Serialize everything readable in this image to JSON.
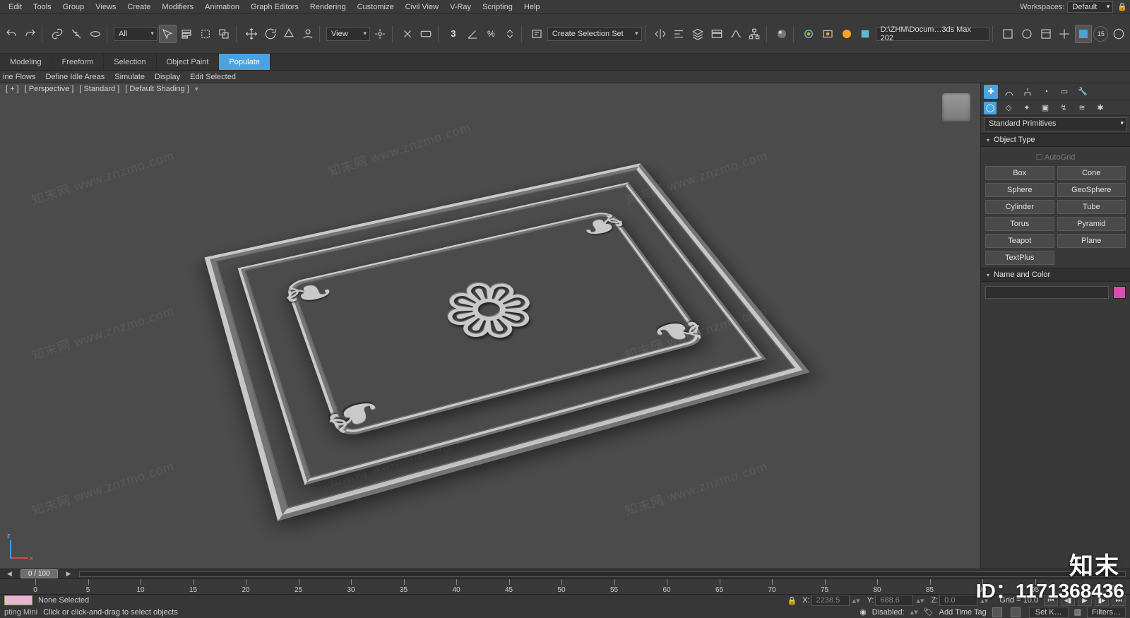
{
  "menu": {
    "items": [
      "Edit",
      "Tools",
      "Group",
      "Views",
      "Create",
      "Modifiers",
      "Animation",
      "Graph Editors",
      "Rendering",
      "Customize",
      "Civil View",
      "V-Ray",
      "Scripting",
      "Help"
    ],
    "workspaces_label": "Workspaces:",
    "workspaces_value": "Default"
  },
  "toolbar": {
    "selset_combo": "All",
    "view_combo": "View",
    "create_sel_set": "Create Selection Set",
    "project_path_field": "D:\\ZHM\\Docum…3ds Max 202",
    "x_spinner": "X:",
    "history_badge": "15"
  },
  "ribbon": {
    "tabs": [
      "Modeling",
      "Freeform",
      "Selection",
      "Object Paint",
      "Populate"
    ],
    "highlight_index": 4
  },
  "substrip": {
    "items": [
      "ine Flows",
      "Define Idle Areas",
      "Simulate",
      "Display",
      "Edit Selected"
    ]
  },
  "viewport": {
    "label_parts": [
      "[ + ]",
      "[ Perspective ]",
      "[ Standard ]",
      "[ Default Shading ]"
    ]
  },
  "cmdpanel": {
    "dropdown": "Standard Primitives",
    "rollout_objtype": "Object Type",
    "autogrid": "AutoGrid",
    "primitives": [
      "Box",
      "Cone",
      "Sphere",
      "GeoSphere",
      "Cylinder",
      "Tube",
      "Torus",
      "Pyramid",
      "Teapot",
      "Plane",
      "TextPlus"
    ],
    "rollout_namecolor": "Name and Color",
    "swatch_color": "#d84fb0"
  },
  "timeslider": {
    "label": "0 / 100"
  },
  "ruler": {
    "ticks": [
      0,
      5,
      10,
      15,
      20,
      25,
      30,
      35,
      40,
      45,
      50,
      55,
      60,
      65,
      70,
      75,
      80,
      85,
      90,
      95
    ],
    "end": 100
  },
  "status": {
    "selection": "None Selected",
    "prompt": "Click or click-and-drag to select objects",
    "script_mini": "pting Mini",
    "lock_icon": "lock",
    "coord_x_label": "X:",
    "coord_x": "2238.5",
    "coord_y_label": "Y:",
    "coord_y": "688.6",
    "coord_z_label": "Z:",
    "coord_z": "0.0",
    "grid_label": "Grid = 10.0",
    "disabled_label": "Disabled:",
    "addtag": "Add Time Tag",
    "setk": "Set K…",
    "filters": "Filters…"
  },
  "watermarks": {
    "site": "知末网 www.znzmo.com",
    "brand": "知末",
    "id": "ID：1171368436"
  }
}
